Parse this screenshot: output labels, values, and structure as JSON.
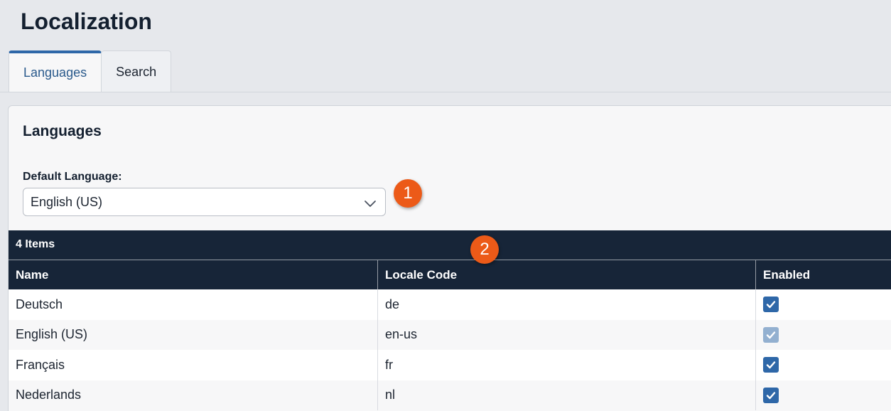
{
  "page": {
    "title": "Localization"
  },
  "tabs": [
    {
      "label": "Languages",
      "active": true
    },
    {
      "label": "Search",
      "active": false
    }
  ],
  "panel": {
    "title": "Languages",
    "default_language": {
      "label": "Default Language:",
      "value": "English (US)"
    }
  },
  "annotations": [
    "1",
    "2"
  ],
  "grid": {
    "count_label": "4 Items",
    "columns": [
      "Name",
      "Locale Code",
      "Enabled"
    ],
    "rows": [
      {
        "name": "Deutsch",
        "code": "de",
        "enabled": true,
        "disabled": false
      },
      {
        "name": "English (US)",
        "code": "en-us",
        "enabled": true,
        "disabled": true
      },
      {
        "name": "Français",
        "code": "fr",
        "enabled": true,
        "disabled": false
      },
      {
        "name": "Nederlands",
        "code": "nl",
        "enabled": true,
        "disabled": false
      }
    ]
  },
  "colors": {
    "accent": "#2e67a8",
    "header_bg": "#172538",
    "badge": "#ec5a18",
    "checkbox": "#2e67a8",
    "checkbox_disabled": "#93b0d0"
  },
  "icons": {
    "select": "chevron-down-icon",
    "check": "check-icon"
  }
}
